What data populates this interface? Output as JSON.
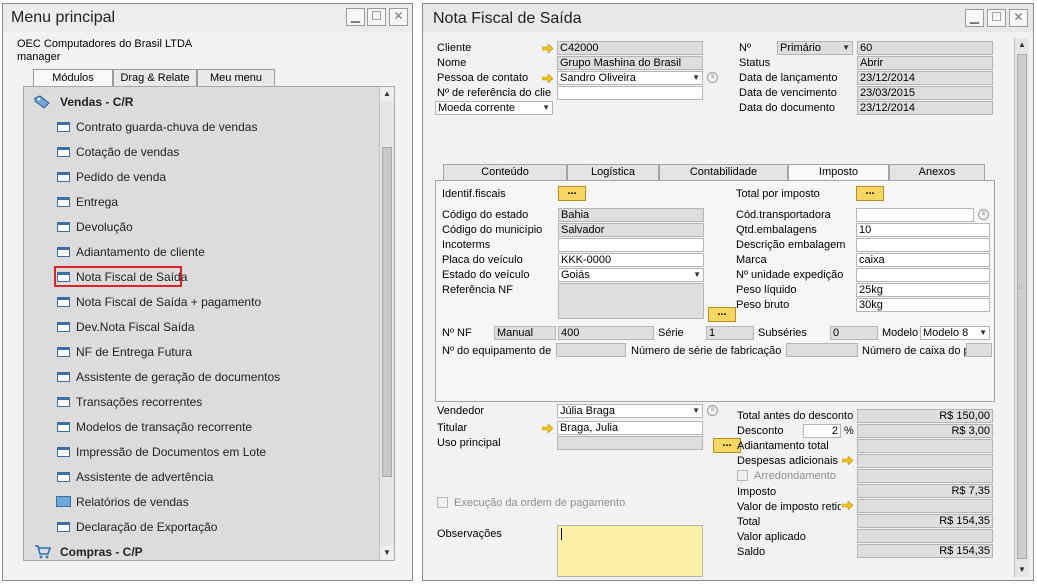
{
  "menu_window": {
    "title": "Menu principal",
    "company": "OEC Computadores do Brasil LTDA",
    "user": "manager",
    "tabs": [
      "Módulos",
      "Drag & Relate",
      "Meu menu"
    ],
    "active_tab": "Módulos",
    "sections": [
      {
        "label": "Vendas - C/R",
        "icon": "sales-tag-icon"
      },
      {
        "label": "Compras - C/P",
        "icon": "shopping-cart-icon"
      }
    ],
    "items": [
      {
        "label": "Contrato guarda-chuva de vendas",
        "icon": "window-icon"
      },
      {
        "label": "Cotação de vendas",
        "icon": "window-icon"
      },
      {
        "label": "Pedido de venda",
        "icon": "window-icon"
      },
      {
        "label": "Entrega",
        "icon": "window-icon"
      },
      {
        "label": "Devolução",
        "icon": "window-icon"
      },
      {
        "label": "Adiantamento de cliente",
        "icon": "window-icon"
      },
      {
        "label": "Nota Fiscal de Saída",
        "icon": "window-icon",
        "highlighted": true
      },
      {
        "label": "Nota Fiscal de Saída + pagamento",
        "icon": "window-icon"
      },
      {
        "label": "Dev.Nota Fiscal Saída",
        "icon": "window-icon"
      },
      {
        "label": "NF de Entrega Futura",
        "icon": "window-icon"
      },
      {
        "label": "Assistente de geração de documentos",
        "icon": "window-icon"
      },
      {
        "label": "Transações recorrentes",
        "icon": "window-icon"
      },
      {
        "label": "Modelos de transação recorrente",
        "icon": "window-icon"
      },
      {
        "label": "Impressão de Documentos em Lote",
        "icon": "window-icon"
      },
      {
        "label": "Assistente de advertência",
        "icon": "window-icon"
      },
      {
        "label": "Relatórios de vendas",
        "icon": "folder-icon"
      },
      {
        "label": "Declaração de Exportação",
        "icon": "window-icon"
      }
    ]
  },
  "nf_window": {
    "title": "Nota Fiscal de Saída",
    "header_left": {
      "cliente_label": "Cliente",
      "cliente": "C42000",
      "nome_label": "Nome",
      "nome": "Grupo Mashina do Brasil",
      "contato_label": "Pessoa de contato",
      "contato": "Sandro Oliveira",
      "referencia_label": "Nº de referência do clie",
      "referencia": "",
      "moeda": "Moeda corrente"
    },
    "header_right": {
      "numero_label": "Nº",
      "serie": "Primário",
      "numero": "60",
      "status_label": "Status",
      "status": "Abrir",
      "lancamento_label": "Data de lançamento",
      "lancamento": "23/12/2014",
      "vencimento_label": "Data de vencimento",
      "vencimento": "23/03/2015",
      "documento_label": "Data do documento",
      "documento": "23/12/2014"
    },
    "tabs": [
      "Conteúdo",
      "Logística",
      "Contabilidade",
      "Imposto",
      "Anexos"
    ],
    "active_tab": "Imposto",
    "imposto": {
      "identif_label": "Identif.fiscais",
      "estado_label": "Código do estado",
      "estado": "Bahia",
      "municipio_label": "Código do município",
      "municipio": "Salvador",
      "incoterms_label": "Incoterms",
      "incoterms": "",
      "placa_label": "Placa do veículo",
      "placa": "KKK-0000",
      "estado_veiculo_label": "Estado do veículo",
      "estado_veiculo": "Goiás",
      "referencia_nf_label": "Referência NF",
      "total_imposto_label": "Total por imposto",
      "transportadora_label": "Cód.transportadora",
      "transportadora": "",
      "qtd_emb_label": "Qtd.embalagens",
      "qtd_emb": "10",
      "desc_emb_label": "Descrição embalagem",
      "desc_emb": "",
      "marca_label": "Marca",
      "marca": "caixa",
      "unidade_label": "Nº unidade expedição",
      "unidade": "",
      "peso_liq_label": "Peso líquido",
      "peso_liq": "25kg",
      "peso_bruto_label": "Peso bruto",
      "peso_bruto": "30kg",
      "nf_label": "Nº NF",
      "nf_tipo": "Manual",
      "nf_numero": "400",
      "serie_label": "Série",
      "serie": "1",
      "subseries_label": "Subséries",
      "subseries": "0",
      "modelo_label": "Modelo",
      "modelo": "Modelo 8",
      "equip_label": "Nº do equipamento de pe",
      "serie_fab_label": "Número de série de fabricação do",
      "caixa_label": "Número de caixa do pe"
    },
    "footer_left": {
      "vendedor_label": "Vendedor",
      "vendedor": "Júlia Braga",
      "titular_label": "Titular",
      "titular": "Braga, Julia",
      "uso_label": "Uso principal",
      "uso": "",
      "execucao_label": "Execução da ordem de pagamento",
      "obs_label": "Observações"
    },
    "totals": {
      "antes_label": "Total antes do desconto",
      "antes": "R$ 150,00",
      "desconto_label": "Desconto",
      "desconto_pct": "2",
      "pct_sign": "%",
      "desconto": "R$ 3,00",
      "adiant_label": "Adiantamento total",
      "adiant": "",
      "despesas_label": "Despesas adicionais",
      "despesas": "",
      "arred_label": "Arredondamento",
      "imposto_label": "Imposto",
      "imposto": "R$ 7,35",
      "retido_label": "Valor de imposto retido",
      "retido": "",
      "total_label": "Total",
      "total": "R$ 154,35",
      "aplicado_label": "Valor aplicado",
      "aplicado": "",
      "saldo_label": "Saldo",
      "saldo": "R$ 154,35"
    },
    "chooser_label": "...",
    "colors": {
      "yellow_field": "#fbf0a6",
      "readonly_field": "#dedede",
      "chooser": "#f7d661",
      "highlight_box": "#d9252a"
    }
  }
}
